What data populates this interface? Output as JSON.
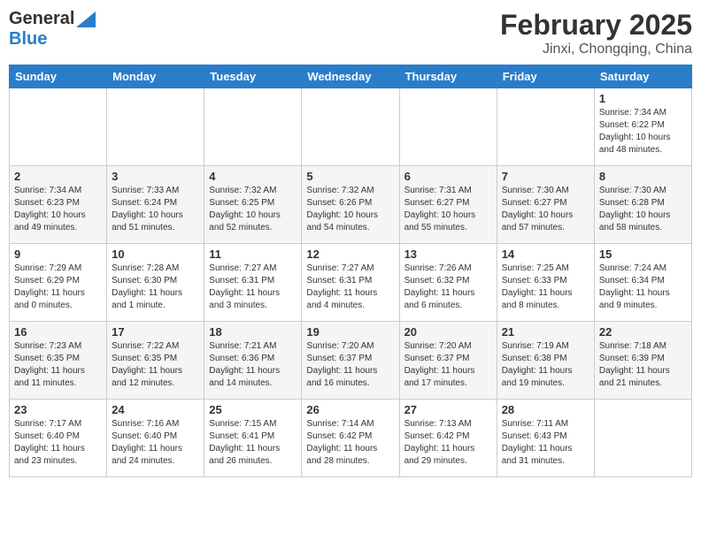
{
  "header": {
    "logo_general": "General",
    "logo_blue": "Blue",
    "month_title": "February 2025",
    "location": "Jinxi, Chongqing, China"
  },
  "weekdays": [
    "Sunday",
    "Monday",
    "Tuesday",
    "Wednesday",
    "Thursday",
    "Friday",
    "Saturday"
  ],
  "weeks": [
    [
      {
        "day": "",
        "info": ""
      },
      {
        "day": "",
        "info": ""
      },
      {
        "day": "",
        "info": ""
      },
      {
        "day": "",
        "info": ""
      },
      {
        "day": "",
        "info": ""
      },
      {
        "day": "",
        "info": ""
      },
      {
        "day": "1",
        "info": "Sunrise: 7:34 AM\nSunset: 6:22 PM\nDaylight: 10 hours and 48 minutes."
      }
    ],
    [
      {
        "day": "2",
        "info": "Sunrise: 7:34 AM\nSunset: 6:23 PM\nDaylight: 10 hours and 49 minutes."
      },
      {
        "day": "3",
        "info": "Sunrise: 7:33 AM\nSunset: 6:24 PM\nDaylight: 10 hours and 51 minutes."
      },
      {
        "day": "4",
        "info": "Sunrise: 7:32 AM\nSunset: 6:25 PM\nDaylight: 10 hours and 52 minutes."
      },
      {
        "day": "5",
        "info": "Sunrise: 7:32 AM\nSunset: 6:26 PM\nDaylight: 10 hours and 54 minutes."
      },
      {
        "day": "6",
        "info": "Sunrise: 7:31 AM\nSunset: 6:27 PM\nDaylight: 10 hours and 55 minutes."
      },
      {
        "day": "7",
        "info": "Sunrise: 7:30 AM\nSunset: 6:27 PM\nDaylight: 10 hours and 57 minutes."
      },
      {
        "day": "8",
        "info": "Sunrise: 7:30 AM\nSunset: 6:28 PM\nDaylight: 10 hours and 58 minutes."
      }
    ],
    [
      {
        "day": "9",
        "info": "Sunrise: 7:29 AM\nSunset: 6:29 PM\nDaylight: 11 hours and 0 minutes."
      },
      {
        "day": "10",
        "info": "Sunrise: 7:28 AM\nSunset: 6:30 PM\nDaylight: 11 hours and 1 minute."
      },
      {
        "day": "11",
        "info": "Sunrise: 7:27 AM\nSunset: 6:31 PM\nDaylight: 11 hours and 3 minutes."
      },
      {
        "day": "12",
        "info": "Sunrise: 7:27 AM\nSunset: 6:31 PM\nDaylight: 11 hours and 4 minutes."
      },
      {
        "day": "13",
        "info": "Sunrise: 7:26 AM\nSunset: 6:32 PM\nDaylight: 11 hours and 6 minutes."
      },
      {
        "day": "14",
        "info": "Sunrise: 7:25 AM\nSunset: 6:33 PM\nDaylight: 11 hours and 8 minutes."
      },
      {
        "day": "15",
        "info": "Sunrise: 7:24 AM\nSunset: 6:34 PM\nDaylight: 11 hours and 9 minutes."
      }
    ],
    [
      {
        "day": "16",
        "info": "Sunrise: 7:23 AM\nSunset: 6:35 PM\nDaylight: 11 hours and 11 minutes."
      },
      {
        "day": "17",
        "info": "Sunrise: 7:22 AM\nSunset: 6:35 PM\nDaylight: 11 hours and 12 minutes."
      },
      {
        "day": "18",
        "info": "Sunrise: 7:21 AM\nSunset: 6:36 PM\nDaylight: 11 hours and 14 minutes."
      },
      {
        "day": "19",
        "info": "Sunrise: 7:20 AM\nSunset: 6:37 PM\nDaylight: 11 hours and 16 minutes."
      },
      {
        "day": "20",
        "info": "Sunrise: 7:20 AM\nSunset: 6:37 PM\nDaylight: 11 hours and 17 minutes."
      },
      {
        "day": "21",
        "info": "Sunrise: 7:19 AM\nSunset: 6:38 PM\nDaylight: 11 hours and 19 minutes."
      },
      {
        "day": "22",
        "info": "Sunrise: 7:18 AM\nSunset: 6:39 PM\nDaylight: 11 hours and 21 minutes."
      }
    ],
    [
      {
        "day": "23",
        "info": "Sunrise: 7:17 AM\nSunset: 6:40 PM\nDaylight: 11 hours and 23 minutes."
      },
      {
        "day": "24",
        "info": "Sunrise: 7:16 AM\nSunset: 6:40 PM\nDaylight: 11 hours and 24 minutes."
      },
      {
        "day": "25",
        "info": "Sunrise: 7:15 AM\nSunset: 6:41 PM\nDaylight: 11 hours and 26 minutes."
      },
      {
        "day": "26",
        "info": "Sunrise: 7:14 AM\nSunset: 6:42 PM\nDaylight: 11 hours and 28 minutes."
      },
      {
        "day": "27",
        "info": "Sunrise: 7:13 AM\nSunset: 6:42 PM\nDaylight: 11 hours and 29 minutes."
      },
      {
        "day": "28",
        "info": "Sunrise: 7:11 AM\nSunset: 6:43 PM\nDaylight: 11 hours and 31 minutes."
      },
      {
        "day": "",
        "info": ""
      }
    ]
  ]
}
